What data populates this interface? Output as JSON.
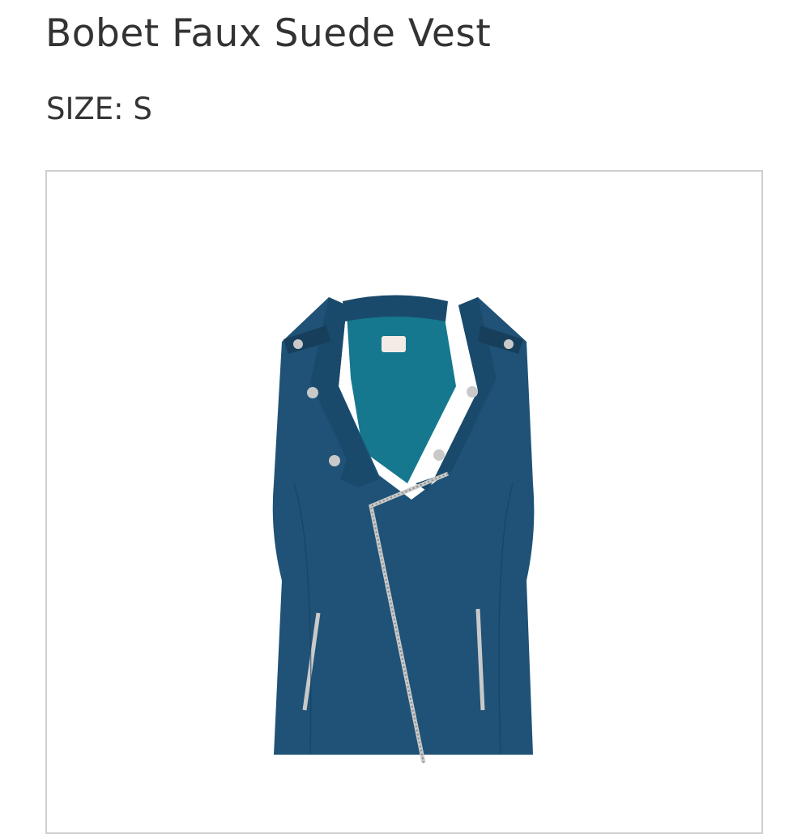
{
  "product": {
    "title": "Bobet Faux Suede Vest",
    "size_label": "SIZE:",
    "size_value": "S"
  },
  "image": {
    "subject": "vest-illustration",
    "colors": {
      "suede": "#1f5276",
      "suede_dark": "#173f5c",
      "lining": "#15788f",
      "hardware": "#c9c9c9",
      "frame_border": "#cfcfcf"
    }
  }
}
